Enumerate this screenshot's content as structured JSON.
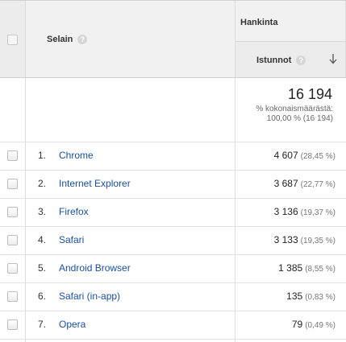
{
  "header": {
    "column_title": "Selain",
    "group_title": "Hankinta",
    "metric_title": "Istunnot",
    "help_glyph": "?"
  },
  "summary": {
    "total": "16 194",
    "line1": "% kokonaismäärästä:",
    "line2": "100,00 % (16 194)"
  },
  "rows": [
    {
      "rank": "1.",
      "name": "Chrome",
      "value": "4 607",
      "pct": "(28,45 %)"
    },
    {
      "rank": "2.",
      "name": "Internet Explorer",
      "value": "3 687",
      "pct": "(22,77 %)"
    },
    {
      "rank": "3.",
      "name": "Firefox",
      "value": "3 136",
      "pct": "(19,37 %)"
    },
    {
      "rank": "4.",
      "name": "Safari",
      "value": "3 133",
      "pct": "(19,35 %)"
    },
    {
      "rank": "5.",
      "name": "Android Browser",
      "value": "1 385",
      "pct": "(8,55 %)"
    },
    {
      "rank": "6.",
      "name": "Safari (in-app)",
      "value": "135",
      "pct": "(0,83 %)"
    },
    {
      "rank": "7.",
      "name": "Opera",
      "value": "79",
      "pct": "(0,49 %)"
    }
  ],
  "icons": {
    "help": "question-mark-circle",
    "sort": "arrow-down",
    "row_select": "checkbox"
  },
  "colors": {
    "link": "#1a4f9c",
    "header_bg": "#f1f1f1",
    "border": "#dcdcdc"
  }
}
